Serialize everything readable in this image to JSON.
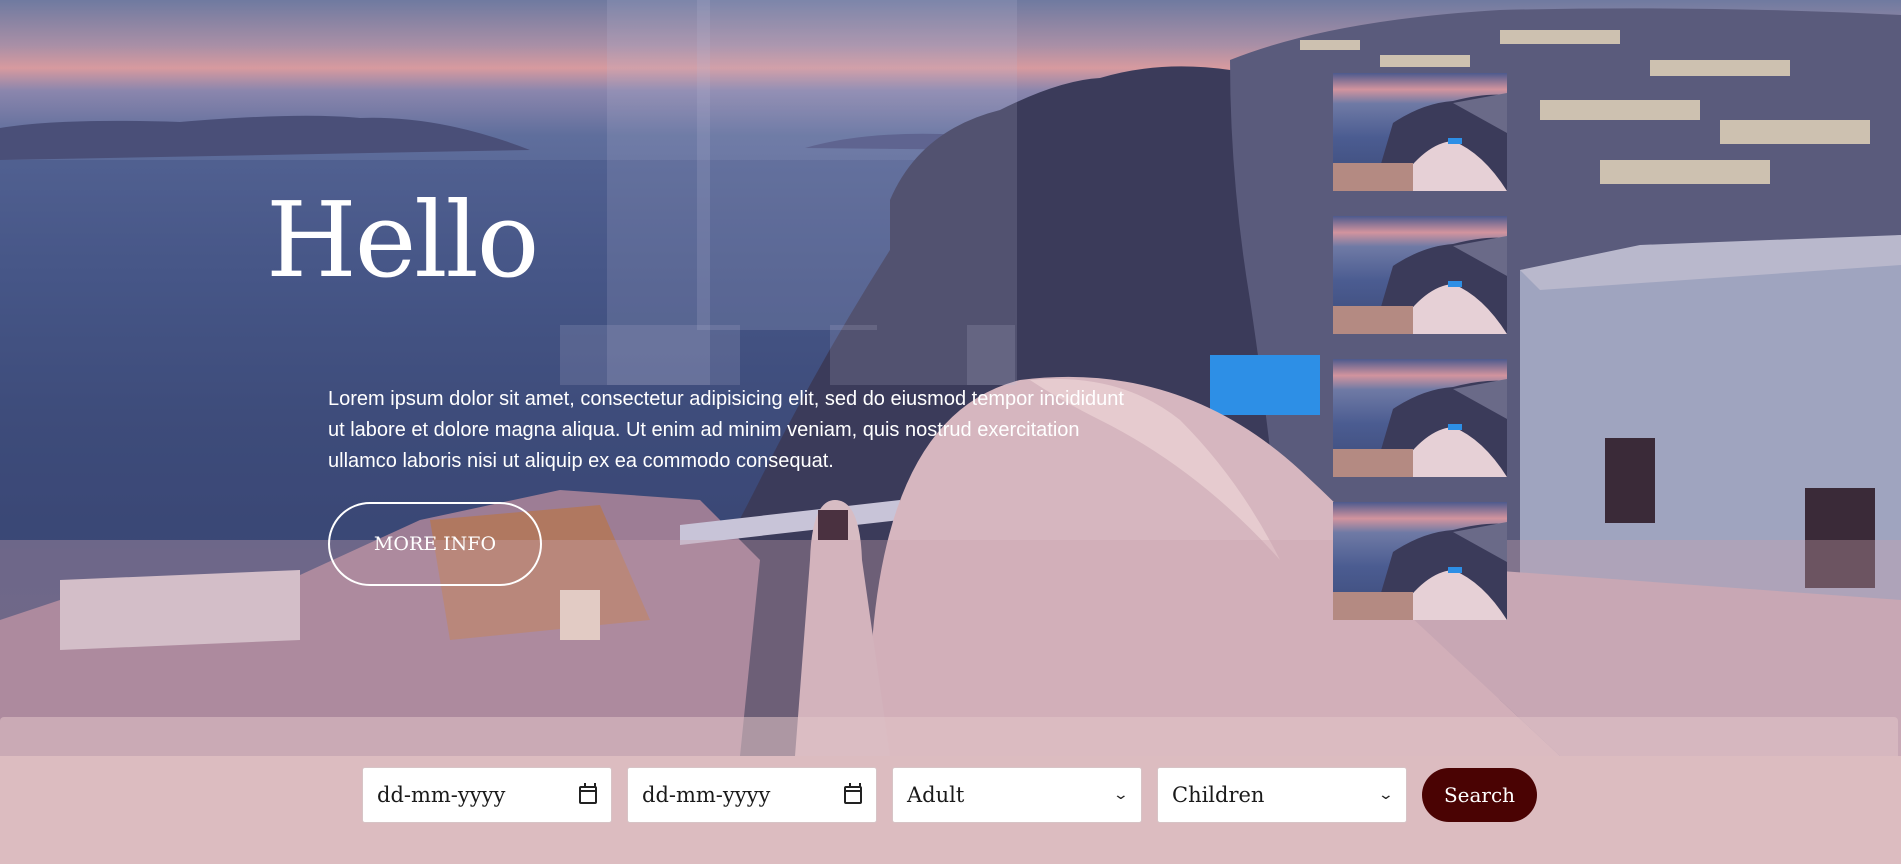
{
  "hero": {
    "title": "Hello",
    "description": "Lorem ipsum dolor sit amet, consectetur adipisicing elit, sed do eiusmod tempor incididunt ut labore et dolore magna aliqua. Ut enim ad minim veniam, quis nostrud exercitation ullamco laboris nisi ut aliquip ex ea commodo consequat.",
    "cta_label": "MORE INFO"
  },
  "thumbnails": [
    {
      "name": "thumbnail-1"
    },
    {
      "name": "thumbnail-2"
    },
    {
      "name": "thumbnail-3"
    },
    {
      "name": "thumbnail-4"
    }
  ],
  "booking": {
    "checkin_placeholder": "dd-mm-yyyy",
    "checkout_placeholder": "dd-mm-yyyy",
    "adult_selected": "Adult",
    "children_selected": "Children",
    "search_label": "Search",
    "icons": {
      "date": "calendar-icon",
      "select": "chevron-down-icon"
    }
  },
  "colors": {
    "booking_bar": "#dcbcc0",
    "search_button": "#4a0303",
    "text_on_hero": "#ffffff"
  }
}
